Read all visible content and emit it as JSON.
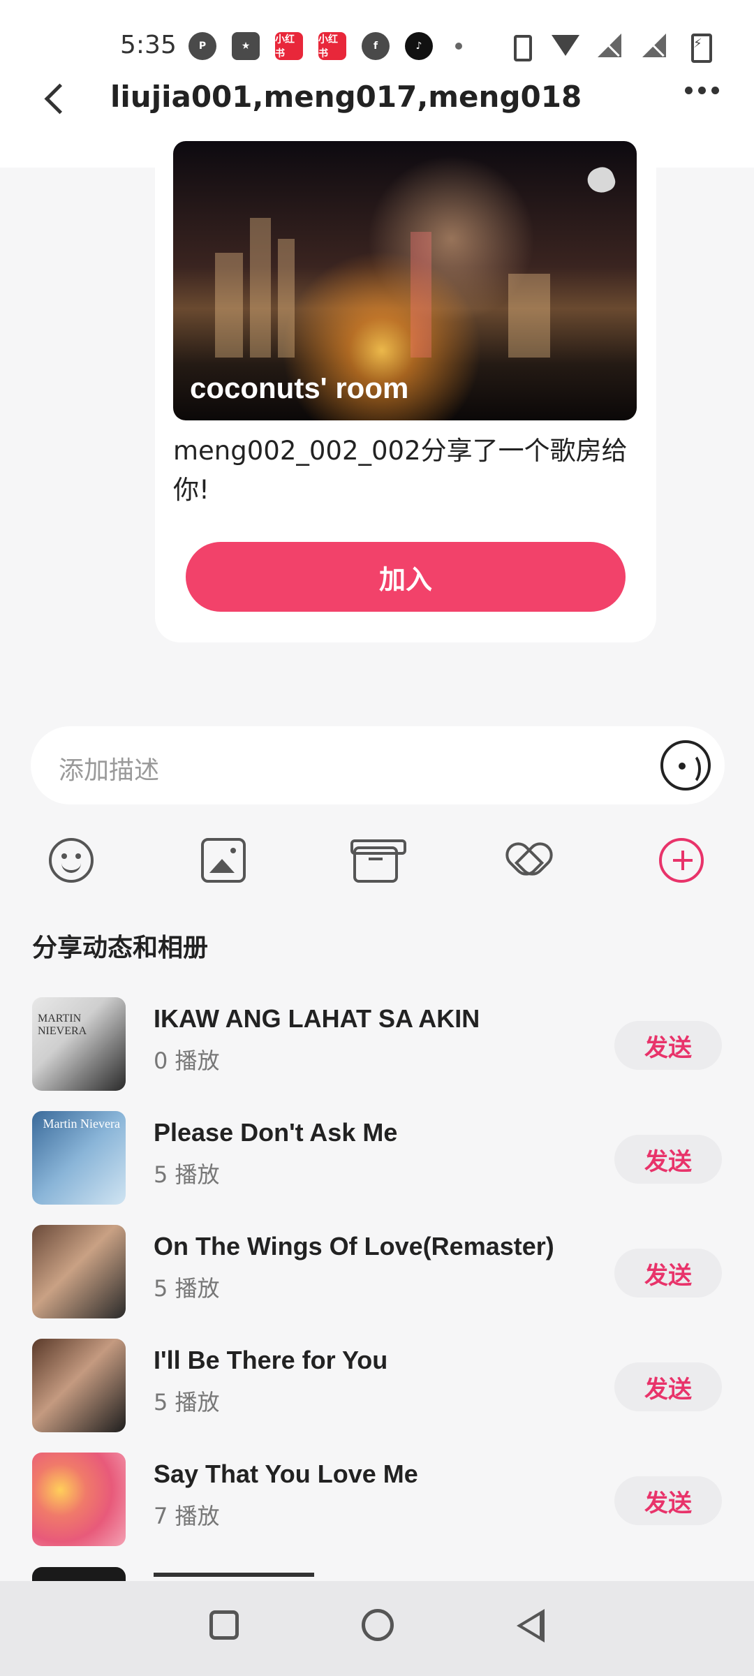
{
  "status_bar": {
    "time": "5:35",
    "left_icons": [
      "pinterest-icon",
      "star-app-icon",
      "xiaohongshu-icon",
      "xiaohongshu-icon",
      "facebook-icon",
      "tiktok-icon",
      "dot-icon"
    ],
    "xhs_label": "小红书",
    "right_icons": [
      "vibrate-icon",
      "wifi-icon",
      "signal-off-icon",
      "signal-off-icon",
      "battery-charging-icon"
    ]
  },
  "header": {
    "title": "liujia001,meng017,meng018"
  },
  "room_card": {
    "room_name": "coconuts' room",
    "share_text": "meng002_002_002分享了一个歌房给你!",
    "join_label": "加入"
  },
  "input": {
    "placeholder": "添加描述"
  },
  "toolbar": {
    "icons": [
      "emoji-icon",
      "image-icon",
      "gift-icon",
      "heart-icon",
      "plus-icon"
    ]
  },
  "section": {
    "title": "分享动态和相册"
  },
  "songs": [
    {
      "title": "IKAW ANG LAHAT SA AKIN",
      "plays": "0 播放",
      "send": "发送",
      "cover_text": "MARTIN NIEVERA"
    },
    {
      "title": "Please Don't Ask Me",
      "plays": "5 播放",
      "send": "发送",
      "cover_text": "Martin Nievera"
    },
    {
      "title": "On The Wings Of Love(Remaster)",
      "plays": "5 播放",
      "send": "发送",
      "cover_text": ""
    },
    {
      "title": "I'll Be There for You",
      "plays": "5 播放",
      "send": "发送",
      "cover_text": ""
    },
    {
      "title": "Say That You Love Me",
      "plays": "7 播放",
      "send": "发送",
      "cover_text": ""
    }
  ],
  "colors": {
    "accent": "#f2426a",
    "send_text": "#e8336a",
    "background": "#f6f6f7"
  }
}
